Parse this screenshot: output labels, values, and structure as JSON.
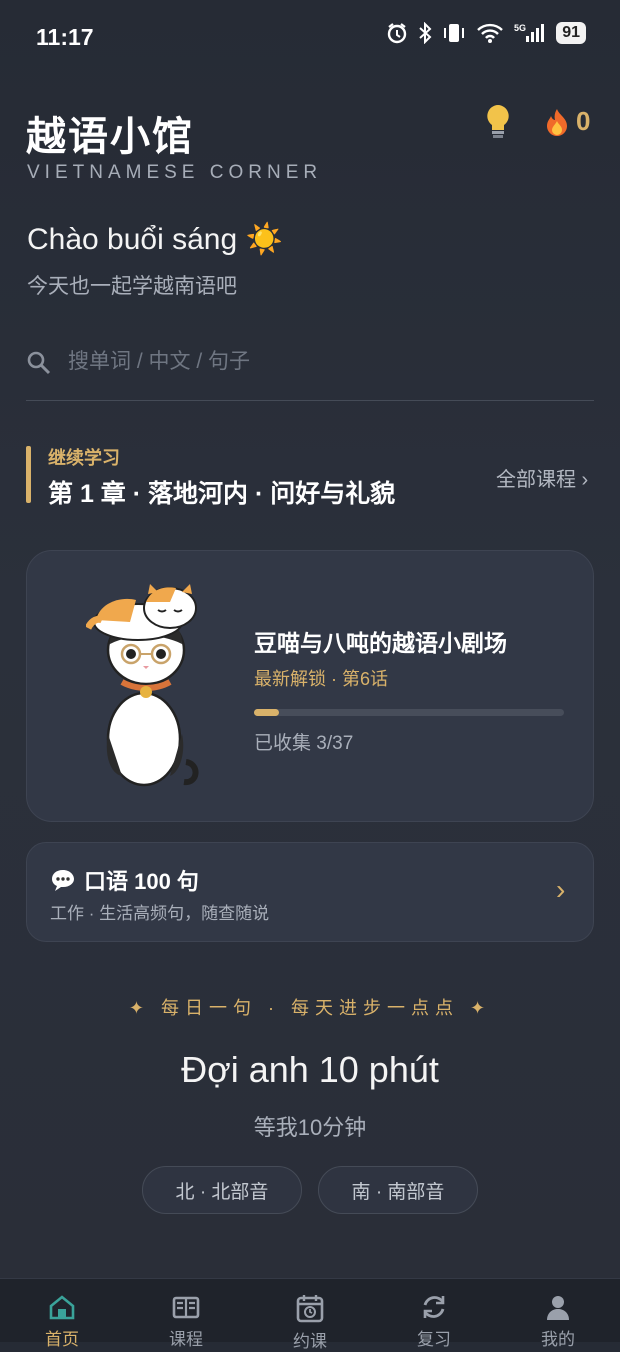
{
  "status": {
    "time": "11:17",
    "battery": "91"
  },
  "header": {
    "title": "越语小馆",
    "subtitle": "VIETNAMESE CORNER",
    "streak": "0"
  },
  "greeting": {
    "title": "Chào buổi sáng ☀️",
    "subtitle": "今天也一起学越南语吧"
  },
  "search": {
    "placeholder": "搜单词 / 中文 / 句子",
    "value": ""
  },
  "continue": {
    "label": "继续学习",
    "chapter": "第 1 章 · 落地河内 · 问好与礼貌",
    "all_courses": "全部课程 ›"
  },
  "feature_card": {
    "title": "豆喵与八吨的越语小剧场",
    "unlock": "最新解锁 · 第6话",
    "collected": "已收集 3/37",
    "progress": 0.081
  },
  "phrases_card": {
    "title": "口语 100 句",
    "subtitle": "工作 · 生活高频句，随查随说",
    "chevron": "›"
  },
  "daily": {
    "label": "✦ 每日一句 · 每天进步一点点 ✦",
    "vietnamese": "Đợi anh 10 phút",
    "chinese": "等我10分钟",
    "north_button": "北 · 北部音",
    "south_button": "南 · 南部音"
  },
  "nav": {
    "items": [
      {
        "label": "首页",
        "icon": "home-icon",
        "active": true
      },
      {
        "label": "课程",
        "icon": "book-icon",
        "active": false
      },
      {
        "label": "约课",
        "icon": "calendar-icon",
        "active": false
      },
      {
        "label": "复习",
        "icon": "refresh-icon",
        "active": false
      },
      {
        "label": "我的",
        "icon": "person-icon",
        "active": false
      }
    ]
  },
  "colors": {
    "accent": "#d9b26a",
    "background": "#2b303b",
    "card": "#323846",
    "nav_active": "#3aa39a"
  }
}
